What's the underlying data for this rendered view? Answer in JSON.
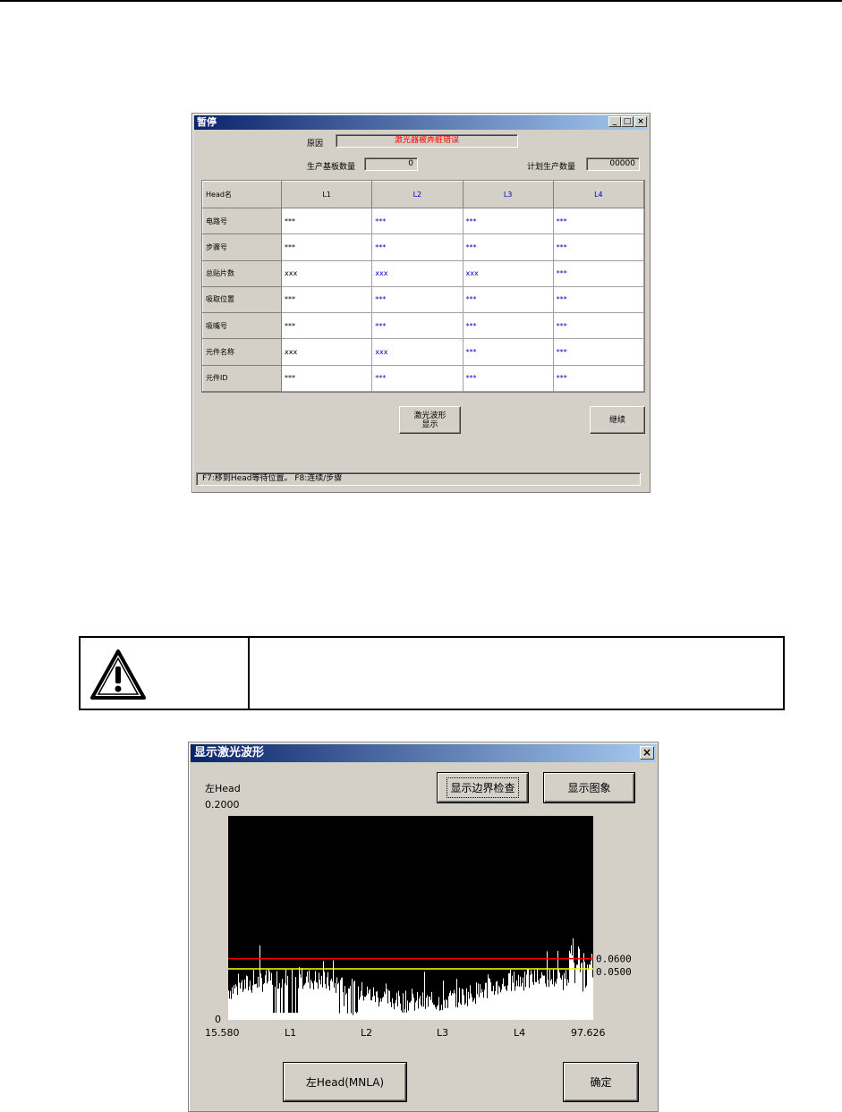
{
  "pause_window": {
    "title": "暂停",
    "reason_label": "原因",
    "reason_value": "激光器被弄脏错误",
    "produced_label": "生产基板数量",
    "produced_value": "0",
    "planned_label": "计划生产数量",
    "planned_value": "00000",
    "table": {
      "corner": "Head名",
      "columns": [
        "L1",
        "L2",
        "L3",
        "L4"
      ],
      "rows": [
        {
          "label": "电路号",
          "cells": [
            "***",
            "***",
            "***",
            "***"
          ]
        },
        {
          "label": "步骤号",
          "cells": [
            "***",
            "***",
            "***",
            "***"
          ]
        },
        {
          "label": "总贴片数",
          "cells": [
            "xxx",
            "xxx",
            "xxx",
            "***"
          ]
        },
        {
          "label": "吸取位置",
          "cells": [
            "***",
            "***",
            "***",
            "***"
          ]
        },
        {
          "label": "吸嘴号",
          "cells": [
            "***",
            "***",
            "***",
            "***"
          ]
        },
        {
          "label": "元件名称",
          "cells": [
            "xxx",
            "xxx",
            "***",
            "***"
          ]
        },
        {
          "label": "元件ID",
          "cells": [
            "***",
            "***",
            "***",
            "***"
          ]
        }
      ]
    },
    "laser_wave_button": "激光波形\n显示",
    "continue_button": "继续",
    "status": "F7:移到Head等待位置。  F8:连续/步骤"
  },
  "laser_window": {
    "title": "显示激光波形",
    "head_label": "左Head",
    "boundary_check_button": "显示边界检查",
    "show_image_button": "显示图象",
    "left_head_button": "左Head(MNLA)",
    "ok_button": "确定",
    "colors": {
      "plot_bg": "#000000",
      "signal": "#ffffff",
      "upper_threshold": "#ff0000",
      "lower_threshold": "#ffff00"
    },
    "chart_data": {
      "type": "area",
      "y_max_label": "0.2000",
      "y_min_label": "0",
      "x_start_label": "15.580",
      "x_end_label": "97.626",
      "x_ticks": [
        "L1",
        "L2",
        "L3",
        "L4"
      ],
      "ylim": [
        0,
        0.2
      ],
      "thresholds": [
        {
          "label": "0.0600",
          "value": 0.06
        },
        {
          "label": "0.0500",
          "value": 0.05
        }
      ],
      "grid": false
    }
  }
}
